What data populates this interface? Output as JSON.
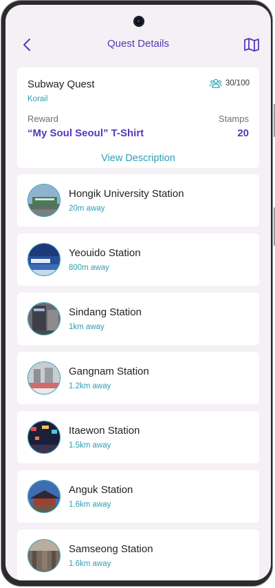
{
  "header": {
    "title": "Quest Details",
    "back_icon": "chevron-left-icon",
    "map_icon": "map-icon",
    "accent_color": "#5537b8"
  },
  "quest": {
    "name": "Subway Quest",
    "organizer": "Korail",
    "members": "30/100",
    "members_icon": "users-icon",
    "reward_label": "Reward",
    "reward_value": "“My Soul Seoul” T-Shirt",
    "stamps_label": "Stamps",
    "stamps_value": "20",
    "view_description": "View Description"
  },
  "stations": [
    {
      "name": "Hongik University Station",
      "distance": "20m away"
    },
    {
      "name": "Yeouido Station",
      "distance": "800m away"
    },
    {
      "name": "Sindang Station",
      "distance": "1km away"
    },
    {
      "name": "Gangnam Station",
      "distance": "1.2km away"
    },
    {
      "name": "Itaewon Station",
      "distance": "1.5km away"
    },
    {
      "name": "Anguk Station",
      "distance": "1.6km away"
    },
    {
      "name": "Samseong Station",
      "distance": "1.6km away"
    }
  ],
  "colors": {
    "background": "#f5f0f5",
    "card": "#ffffff",
    "secondary_accent": "#2d9fb3"
  }
}
